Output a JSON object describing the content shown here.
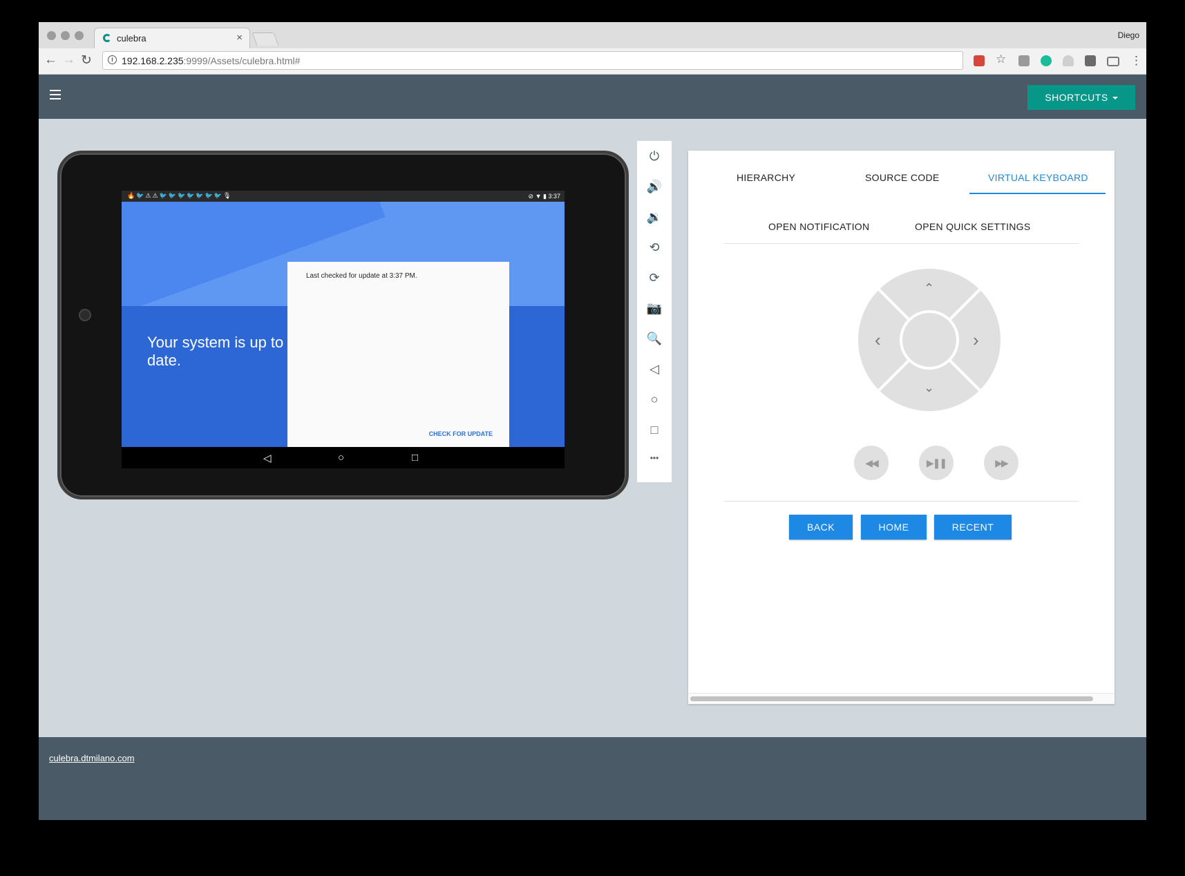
{
  "browser": {
    "tab_title": "culebra",
    "tab_close": "×",
    "profile_name": "Diego",
    "url_host": "192.168.2.235",
    "url_rest": ":9999/Assets/culebra.html#",
    "nav": {
      "back": "←",
      "forward": "→",
      "reload": "↻"
    },
    "info_glyph": "i",
    "menu_glyph": "⋮"
  },
  "appbar": {
    "shortcuts_label": "SHORTCUTS"
  },
  "device": {
    "status_left": "🔥🐦⚠⚠🐦🐦🐦🐦🐦🐦🐦🎙",
    "status_time": "3:37",
    "status_right_icons": "⊘ ▼ ▮",
    "headline": "Your system is up to date.",
    "card_message": "Last checked for update at 3:37 PM.",
    "card_button": "CHECK FOR UPDATE",
    "navbar": {
      "back": "◁",
      "home": "○",
      "recent": "□"
    }
  },
  "sidebar": {
    "icons": [
      "⏻",
      "🔊",
      "🔉",
      "⟲",
      "⟳",
      "📷",
      "🔍",
      "◁",
      "○",
      "□",
      "•••"
    ]
  },
  "panel": {
    "tabs": [
      "HIERARCHY",
      "SOURCE CODE",
      "VIRTUAL KEYBOARD"
    ],
    "active_tab": "VIRTUAL KEYBOARD",
    "subtabs": [
      "OPEN NOTIFICATION",
      "OPEN QUICK SETTINGS"
    ],
    "dpad": {
      "up": "⌃",
      "down": "⌄",
      "left": "‹",
      "right": "›"
    },
    "media": {
      "rewind": "◀◀",
      "play_pause": "▶❚❚",
      "fast_forward": "▶▶"
    },
    "buttons": {
      "back": "BACK",
      "home": "HOME",
      "recent": "RECENT"
    }
  },
  "footer": {
    "link_text": "culebra.dtmilano.com"
  },
  "colors": {
    "appbar": "#4a5b67",
    "accent_teal": "#079789",
    "accent_blue": "#1e88e5"
  }
}
